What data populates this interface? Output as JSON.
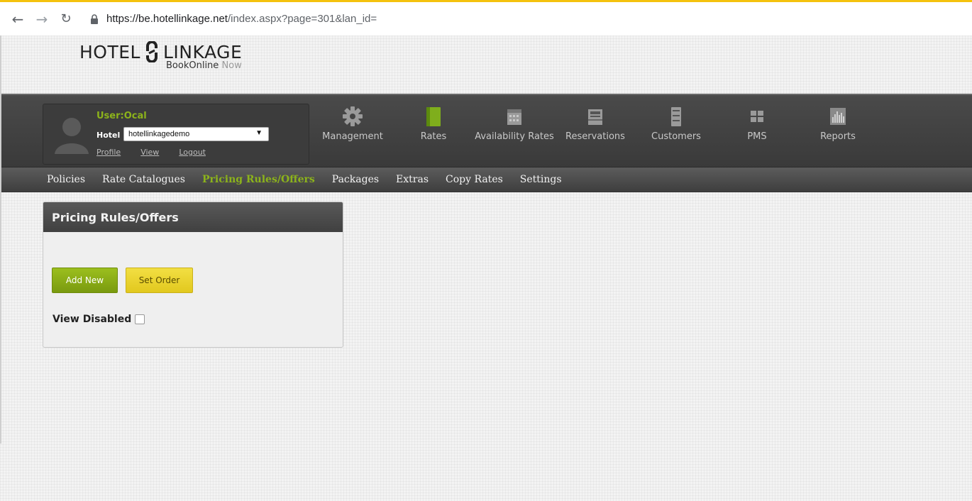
{
  "browser": {
    "url_domain": "https://be.hotellinkage.net",
    "url_path": "/index.aspx?page=301&lan_id="
  },
  "logo": {
    "hotel": "HOTEL",
    "linkage": "LINKAGE",
    "sub_bookonline": "BookOnline",
    "sub_now": "Now"
  },
  "user": {
    "name": "User:Ocal",
    "hotel_label": "Hotel",
    "hotel_value": "hotellinkagedemo",
    "links": [
      "Profile",
      "View",
      "Logout"
    ]
  },
  "main_nav": [
    {
      "label": "Management",
      "icon": "gear-icon"
    },
    {
      "label": "Rates",
      "icon": "book-icon"
    },
    {
      "label": "Availability Rates",
      "icon": "calendar-icon"
    },
    {
      "label": "Reservations",
      "icon": "inbox-icon"
    },
    {
      "label": "Customers",
      "icon": "cabinet-icon"
    },
    {
      "label": "PMS",
      "icon": "grid-icon"
    },
    {
      "label": "Reports",
      "icon": "bar-chart-icon"
    }
  ],
  "sub_nav": [
    {
      "label": "Policies",
      "active": false
    },
    {
      "label": "Rate Catalogues",
      "active": false
    },
    {
      "label": "Pricing Rules/Offers",
      "active": true
    },
    {
      "label": "Packages",
      "active": false
    },
    {
      "label": "Extras",
      "active": false
    },
    {
      "label": "Copy Rates",
      "active": false
    },
    {
      "label": "Settings",
      "active": false
    }
  ],
  "panel": {
    "title": "Pricing Rules/Offers",
    "add_new": "Add New",
    "set_order": "Set Order",
    "view_disabled": "View Disabled",
    "view_disabled_checked": false
  },
  "colors": {
    "accent_green": "#8cb31b",
    "button_yellow": "#e9d531",
    "header_dark": "#3f3f3f"
  }
}
